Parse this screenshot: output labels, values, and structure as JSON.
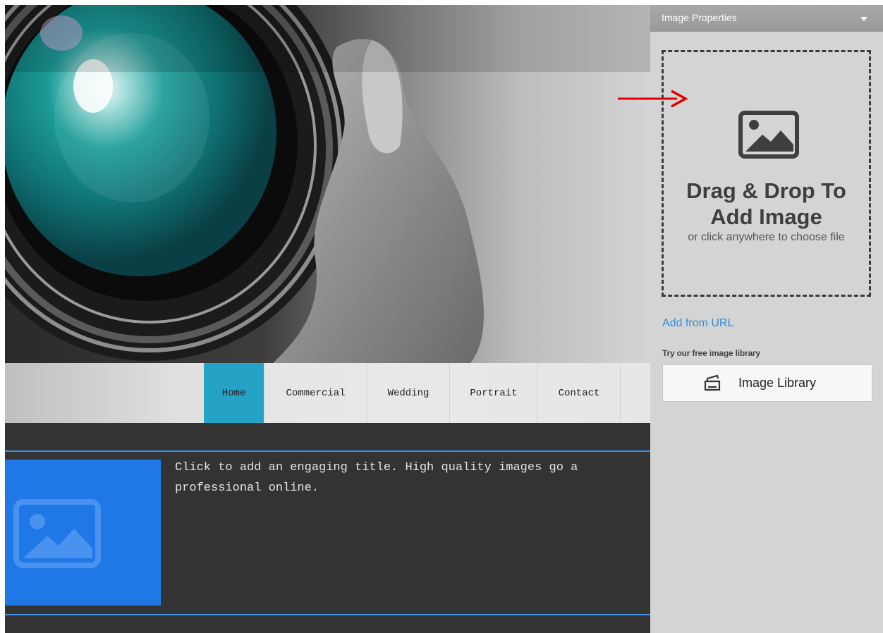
{
  "preview": {
    "nav": {
      "items": [
        {
          "label": "Home",
          "active": true
        },
        {
          "label": "Commercial",
          "active": false
        },
        {
          "label": "Wedding",
          "active": false
        },
        {
          "label": "Portrait",
          "active": false
        },
        {
          "label": "Contact",
          "active": false
        }
      ]
    },
    "content": {
      "title": "Click to add an engaging title. High quality images go a\nprofessional online."
    }
  },
  "panel": {
    "title": "Image Properties",
    "dropzone": {
      "title": "Drag & Drop To\nAdd Image",
      "subtitle": "or click anywhere to choose file"
    },
    "add_url_label": "Add from URL",
    "library_caption": "Try our free image library",
    "library_button_label": "Image Library"
  },
  "colors": {
    "active_nav": "#25a3c6",
    "placeholder_blue": "#1f78e6",
    "link_blue": "#2f8de0",
    "annotation_red": "#e00000"
  },
  "icons": [
    "image-icon",
    "image-placeholder-icon",
    "image-library-icon",
    "chevron-down-icon"
  ]
}
